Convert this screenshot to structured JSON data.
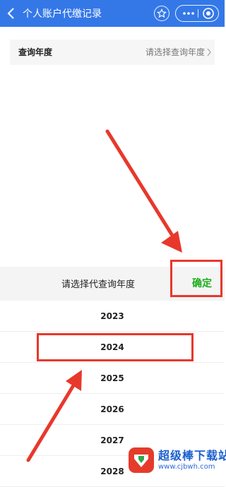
{
  "header": {
    "title": "个人账户代缴记录",
    "icons": [
      "back-icon",
      "star-icon",
      "more-icon",
      "close-target-icon"
    ],
    "color": "#3478e8"
  },
  "query": {
    "label": "查询年度",
    "value": "请选择查询年度",
    "icon": "chevron-right-icon"
  },
  "picker": {
    "title": "请选择代查询年度",
    "confirm_label": "确定",
    "confirm_color": "#1aad19",
    "years": [
      "2023",
      "2024",
      "2025",
      "2026",
      "2027",
      "2028"
    ],
    "selected": "2024"
  },
  "annotation": {
    "color": "#e8382b"
  },
  "watermark": {
    "name": "超级棒下载站",
    "url": "www.cjbwh.com"
  }
}
